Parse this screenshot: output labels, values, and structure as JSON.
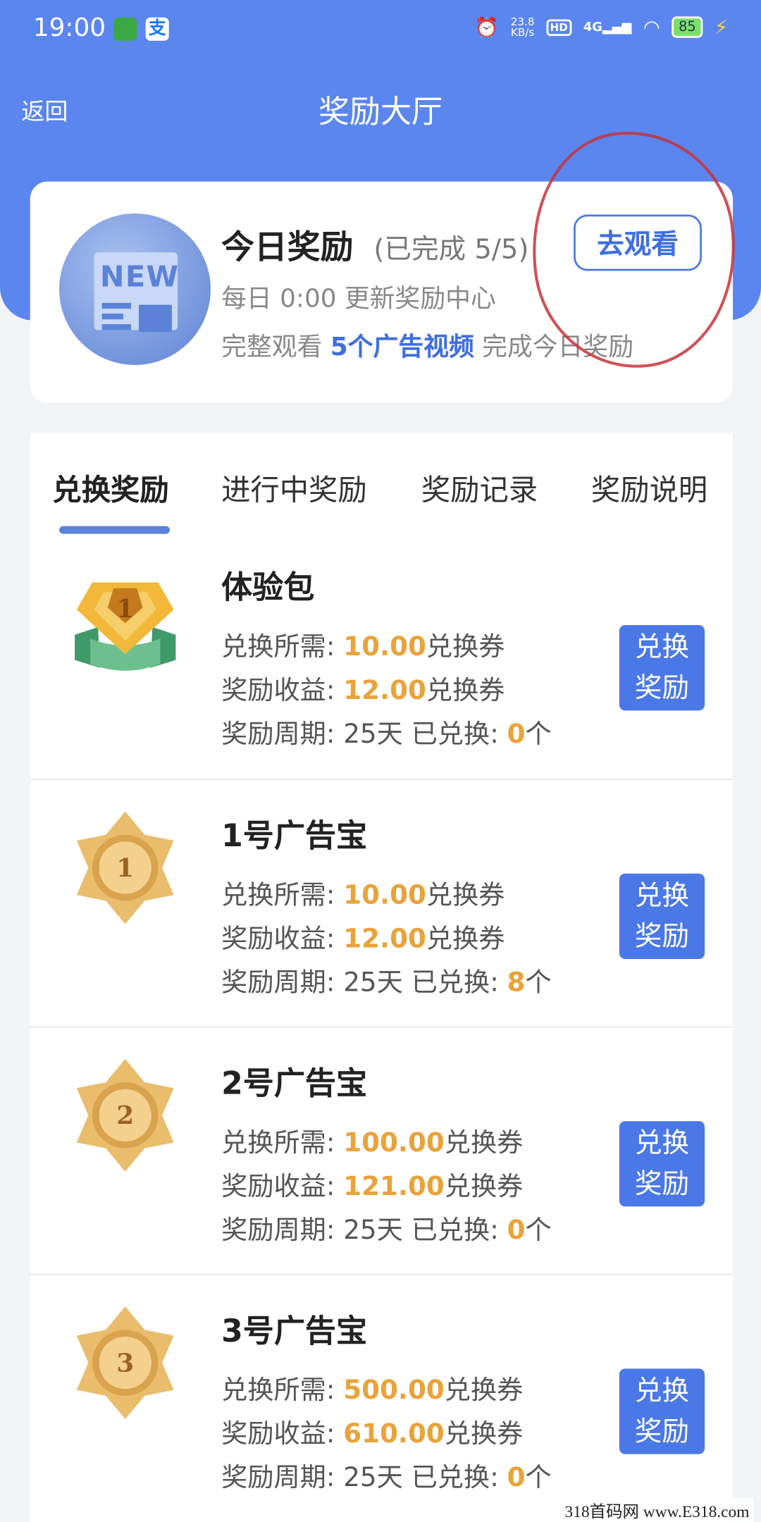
{
  "status_bar": {
    "time": "19:00",
    "net_speed_value": "23.8",
    "net_speed_unit": "KB/s",
    "hd_label": "HD",
    "signal_label": "4G",
    "battery": "85"
  },
  "header": {
    "back_label": "返回",
    "title": "奖励大厅"
  },
  "today_reward": {
    "title": "今日奖励",
    "status": "(已完成 5/5)",
    "subtitle": "每日 0:00 更新奖励中心",
    "desc_prefix": "完整观看",
    "desc_highlight": "5个广告视频",
    "desc_suffix": "完成今日奖励",
    "watch_button": "去观看",
    "icon_text": "NEW"
  },
  "tabs": [
    {
      "label": "兑换奖励",
      "active": true
    },
    {
      "label": "进行中奖励",
      "active": false
    },
    {
      "label": "奖励记录",
      "active": false
    },
    {
      "label": "奖励说明",
      "active": false
    }
  ],
  "labels": {
    "cost": "兑换所需:",
    "reward": "奖励收益:",
    "period": "奖励周期:",
    "unit": "兑换券",
    "redeemed": "已兑换:",
    "count_unit": "个",
    "button_line1": "兑换",
    "button_line2": "奖励"
  },
  "items": [
    {
      "name": "体验包",
      "badge": "1",
      "cost": "10.00",
      "reward": "12.00",
      "period": "25天",
      "redeemed": "0"
    },
    {
      "name": "1号广告宝",
      "badge": "1",
      "cost": "10.00",
      "reward": "12.00",
      "period": "25天",
      "redeemed": "8"
    },
    {
      "name": "2号广告宝",
      "badge": "2",
      "cost": "100.00",
      "reward": "121.00",
      "period": "25天",
      "redeemed": "0"
    },
    {
      "name": "3号广告宝",
      "badge": "3",
      "cost": "500.00",
      "reward": "610.00",
      "period": "25天",
      "redeemed": "0"
    }
  ],
  "watermark": "318首码网 www.E318.com",
  "colors": {
    "header_blue": "#5b86ef",
    "accent_blue": "#4a78e6",
    "gold": "#e8a33a",
    "annotation_red": "#c7323a"
  }
}
